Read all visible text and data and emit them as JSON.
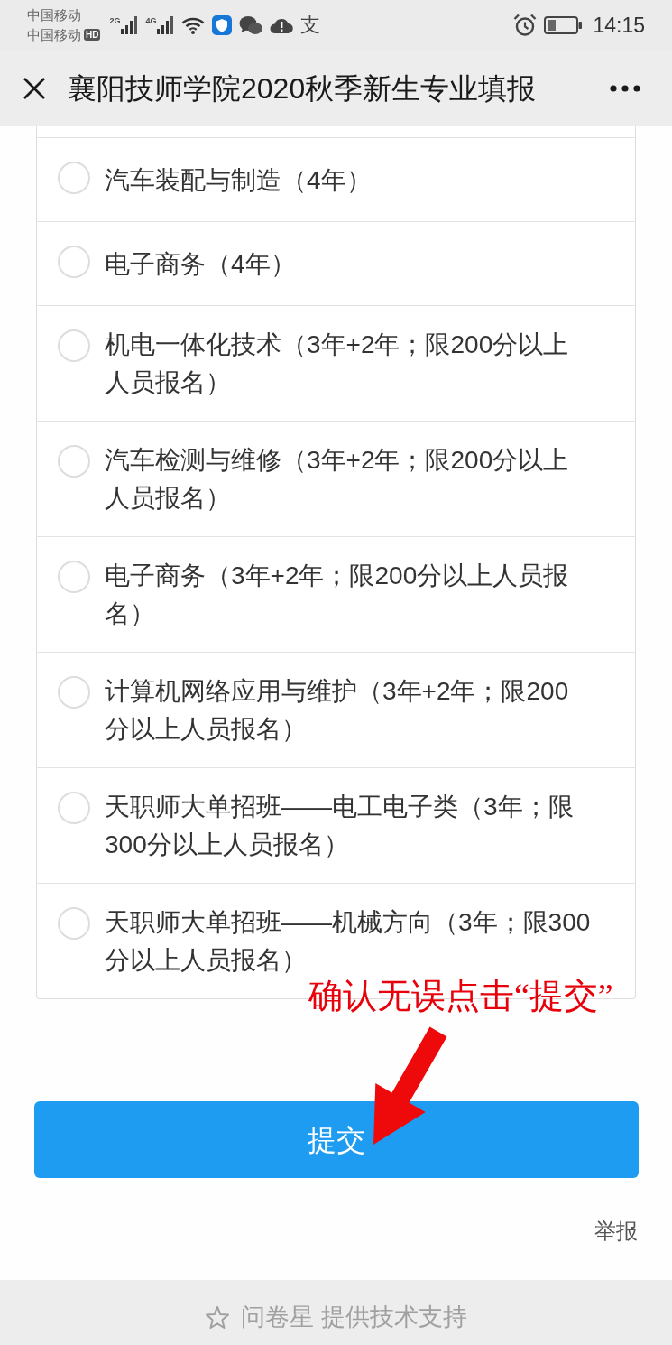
{
  "status_bar": {
    "carriers": [
      {
        "name": "中国移动"
      },
      {
        "name": "中国移动",
        "badge": "HD"
      }
    ],
    "networks": [
      {
        "label": "2G"
      },
      {
        "label": "4G"
      }
    ],
    "notification_glyph": "支",
    "time": "14:15"
  },
  "header": {
    "title": "襄阳技师学院2020秋季新生专业填报"
  },
  "question": {
    "options": [
      {
        "label": "汽车装配与制造（4年）",
        "selected": false
      },
      {
        "label": "电子商务（4年）",
        "selected": false
      },
      {
        "label": "机电一体化技术（3年+2年；限200分以上人员报名）",
        "selected": false
      },
      {
        "label": "汽车检测与维修（3年+2年；限200分以上人员报名）",
        "selected": false
      },
      {
        "label": "电子商务（3年+2年；限200分以上人员报名）",
        "selected": false
      },
      {
        "label": "计算机网络应用与维护（3年+2年；限200分以上人员报名）",
        "selected": false
      },
      {
        "label": "天职师大单招班——电工电子类（3年；限300分以上人员报名）",
        "selected": false
      },
      {
        "label": "天职师大单招班——机械方向（3年；限300分以上人员报名）",
        "selected": false
      }
    ]
  },
  "annotation": {
    "text": "确认无误点击“提交”"
  },
  "submit_button": {
    "label": "提交"
  },
  "report_link": {
    "label": "举报"
  },
  "footer": {
    "text": "问卷星 提供技术支持"
  }
}
